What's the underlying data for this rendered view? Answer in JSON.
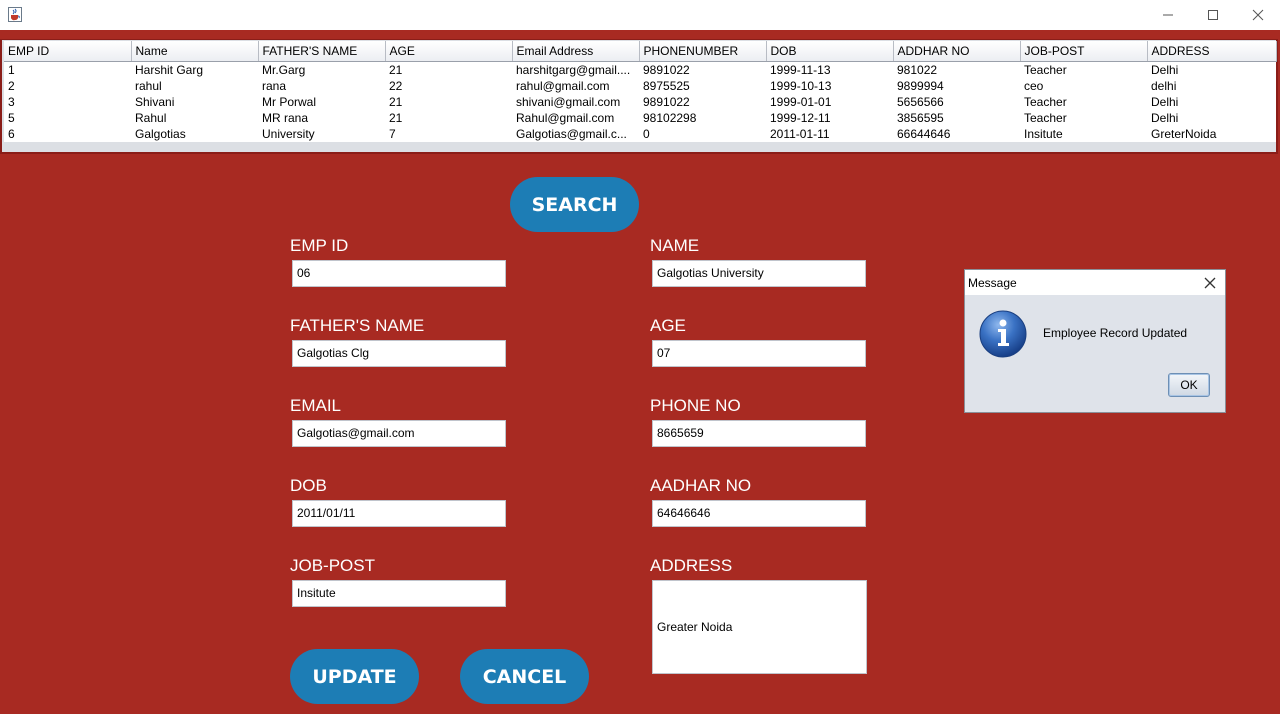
{
  "window": {
    "app_icon": "java-cup-icon",
    "controls": [
      "minimize-icon",
      "maximize-icon",
      "close-icon"
    ]
  },
  "table": {
    "columns": [
      "EMP ID",
      "Name",
      "FATHER'S NAME",
      "AGE",
      "Email Address",
      "PHONENUMBER",
      "DOB",
      "ADDHAR NO",
      "JOB-POST",
      "ADDRESS"
    ],
    "rows": [
      [
        "1",
        "Harshit Garg",
        "Mr.Garg",
        "21",
        "harshitgarg@gmail....",
        "9891022",
        "1999-11-13",
        "981022",
        "Teacher",
        "Delhi"
      ],
      [
        "2",
        "rahul",
        "rana",
        "22",
        "rahul@gmail.com",
        "8975525",
        "1999-10-13",
        "9899994",
        "ceo",
        "delhi"
      ],
      [
        "3",
        "Shivani",
        "Mr Porwal",
        "21",
        "shivani@gmail.com",
        "9891022",
        "1999-01-01",
        "5656566",
        "Teacher",
        "Delhi"
      ],
      [
        "5",
        "Rahul",
        "MR rana",
        "21",
        "Rahul@gmail.com",
        "98102298",
        "1999-12-11",
        "3856595",
        "Teacher",
        "Delhi"
      ],
      [
        "6",
        "Galgotias",
        "University",
        "7",
        "Galgotias@gmail.c...",
        "0",
        "2011-01-11",
        "66644646",
        "Insitute",
        "GreterNoida"
      ]
    ]
  },
  "form": {
    "search_label": "SEARCH",
    "emp_id": {
      "label": "EMP ID",
      "value": "06"
    },
    "name": {
      "label": "NAME",
      "value": "Galgotias University"
    },
    "fathers_name": {
      "label": "FATHER'S NAME",
      "value": "Galgotias Clg"
    },
    "age": {
      "label": "AGE",
      "value": "07"
    },
    "email": {
      "label": "EMAIL",
      "value": "Galgotias@gmail.com"
    },
    "phone": {
      "label": "PHONE NO",
      "value": "8665659"
    },
    "dob": {
      "label": "DOB",
      "value": "2011/01/11"
    },
    "aadhar": {
      "label": "AADHAR NO",
      "value": "64646646"
    },
    "job_post": {
      "label": "JOB-POST",
      "value": "Insitute"
    },
    "address": {
      "label": "ADDRESS",
      "value": "Greater Noida"
    },
    "update_label": "UPDATE",
    "cancel_label": "CANCEL"
  },
  "dialog": {
    "title": "Message",
    "message": "Employee Record Updated",
    "ok_label": "OK",
    "icon": "info-icon"
  },
  "colors": {
    "background": "#a82a22",
    "button": "#1d7db5",
    "info_icon": "#1f5fae"
  }
}
